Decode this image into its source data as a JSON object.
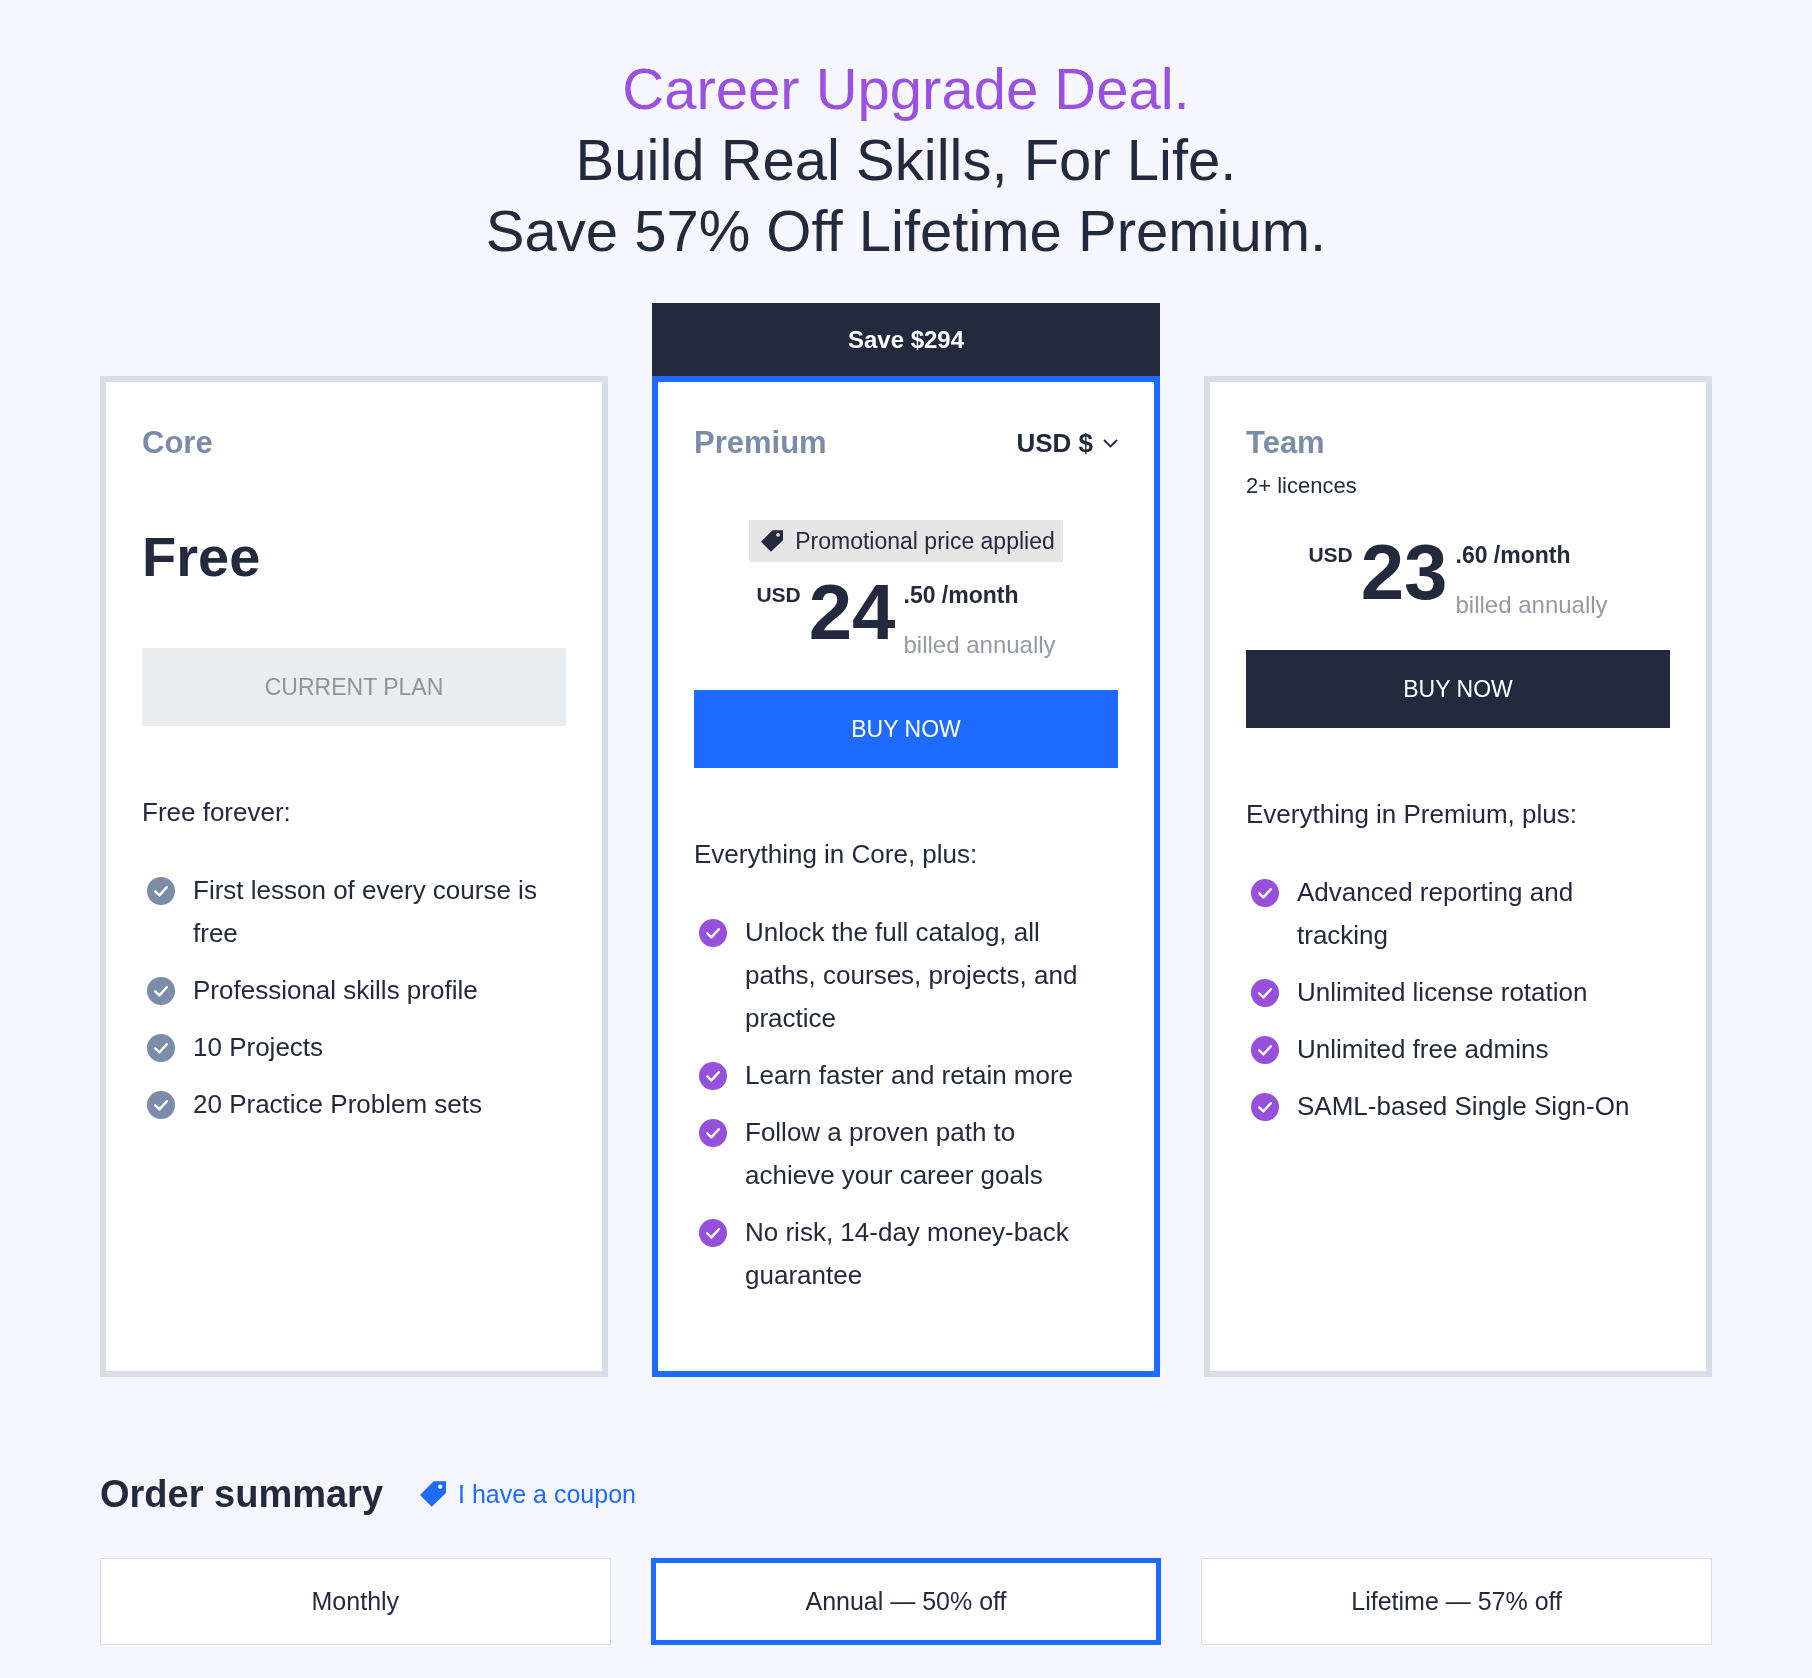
{
  "headline": {
    "accent": "Career Upgrade Deal.",
    "lines": [
      "Build Real Skills, For Life.",
      "Save 57% Off Lifetime Premium."
    ]
  },
  "plans": [
    {
      "kind": "free",
      "name": "Core",
      "highlighted": false,
      "price": "Free",
      "button": {
        "label": "CURRENT PLAN",
        "disabled": true
      },
      "intro": "Free forever:",
      "features": [
        "First lesson of every course is free",
        "Professional skills profile",
        "10 Projects",
        "20 Practice Problem sets"
      ]
    },
    {
      "kind": "paid",
      "name": "Premium",
      "highlighted": true,
      "banner": "Save $294",
      "currency_selector": "USD $",
      "promo": "Promotional price applied",
      "price": {
        "currency": "USD",
        "amount": "24",
        "cents": ".50 /month",
        "note": "billed annually"
      },
      "button": {
        "label": "BUY NOW",
        "disabled": false
      },
      "intro": "Everything in Core, plus:",
      "features": [
        "Unlock the full catalog, all paths, courses, projects, and practice",
        "Learn faster and retain more",
        "Follow a proven path to achieve your career goals",
        "No risk, 14-day money-back guarantee"
      ]
    },
    {
      "kind": "paid",
      "name": "Team",
      "highlighted": false,
      "subtitle": "2+ licences",
      "price": {
        "currency": "USD",
        "amount": "23",
        "cents": ".60 /month",
        "note": "billed annually"
      },
      "button": {
        "label": "BUY NOW",
        "disabled": false
      },
      "intro": "Everything in Premium, plus:",
      "features": [
        "Advanced reporting and tracking",
        "Unlimited license rotation",
        "Unlimited free admins",
        "SAML-based Single Sign-On"
      ]
    }
  ],
  "order_summary": {
    "title": "Order summary",
    "coupon_link": "I have a coupon",
    "options": [
      {
        "label": "Monthly",
        "selected": false
      },
      {
        "label": "Annual — 50% off",
        "selected": true
      },
      {
        "label": "Lifetime — 57% off",
        "selected": false
      }
    ]
  }
}
